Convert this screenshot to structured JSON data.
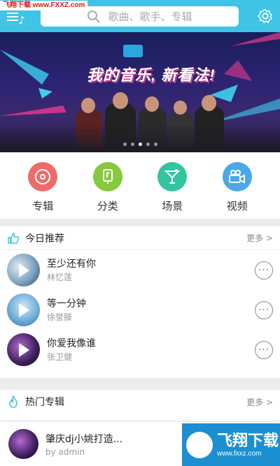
{
  "watermark_top": "飞翔下载 www.FXXZ.com",
  "search": {
    "placeholder": "歌曲、歌手、专辑"
  },
  "banner": {
    "title": "我的音乐, 新看法!",
    "slide_count": 5,
    "active_slide": 2
  },
  "categories": [
    {
      "label": "专辑",
      "icon": "disc-icon",
      "color": "#ef6b6b"
    },
    {
      "label": "分类",
      "icon": "mic-icon",
      "color": "#86c93c"
    },
    {
      "label": "场景",
      "icon": "cocktail-icon",
      "color": "#33c4a0"
    },
    {
      "label": "视频",
      "icon": "video-camera-icon",
      "color": "#4aa8e8"
    }
  ],
  "recommend": {
    "title": "今日推荐",
    "more": "更多 >",
    "songs": [
      {
        "title": "至少还有你",
        "artist": "林忆莲"
      },
      {
        "title": "等一分钟",
        "artist": "徐誉滕"
      },
      {
        "title": "你爱我像谁",
        "artist": "张卫健"
      }
    ]
  },
  "hot_albums": {
    "title": "热门专辑",
    "more": "更多 >"
  },
  "now_playing": {
    "title": "肇庆dj小姚打造...",
    "subtitle": "by admin"
  },
  "watermark_bottom": {
    "brand": "飞翔下载",
    "url": "www.fxxz.com"
  }
}
